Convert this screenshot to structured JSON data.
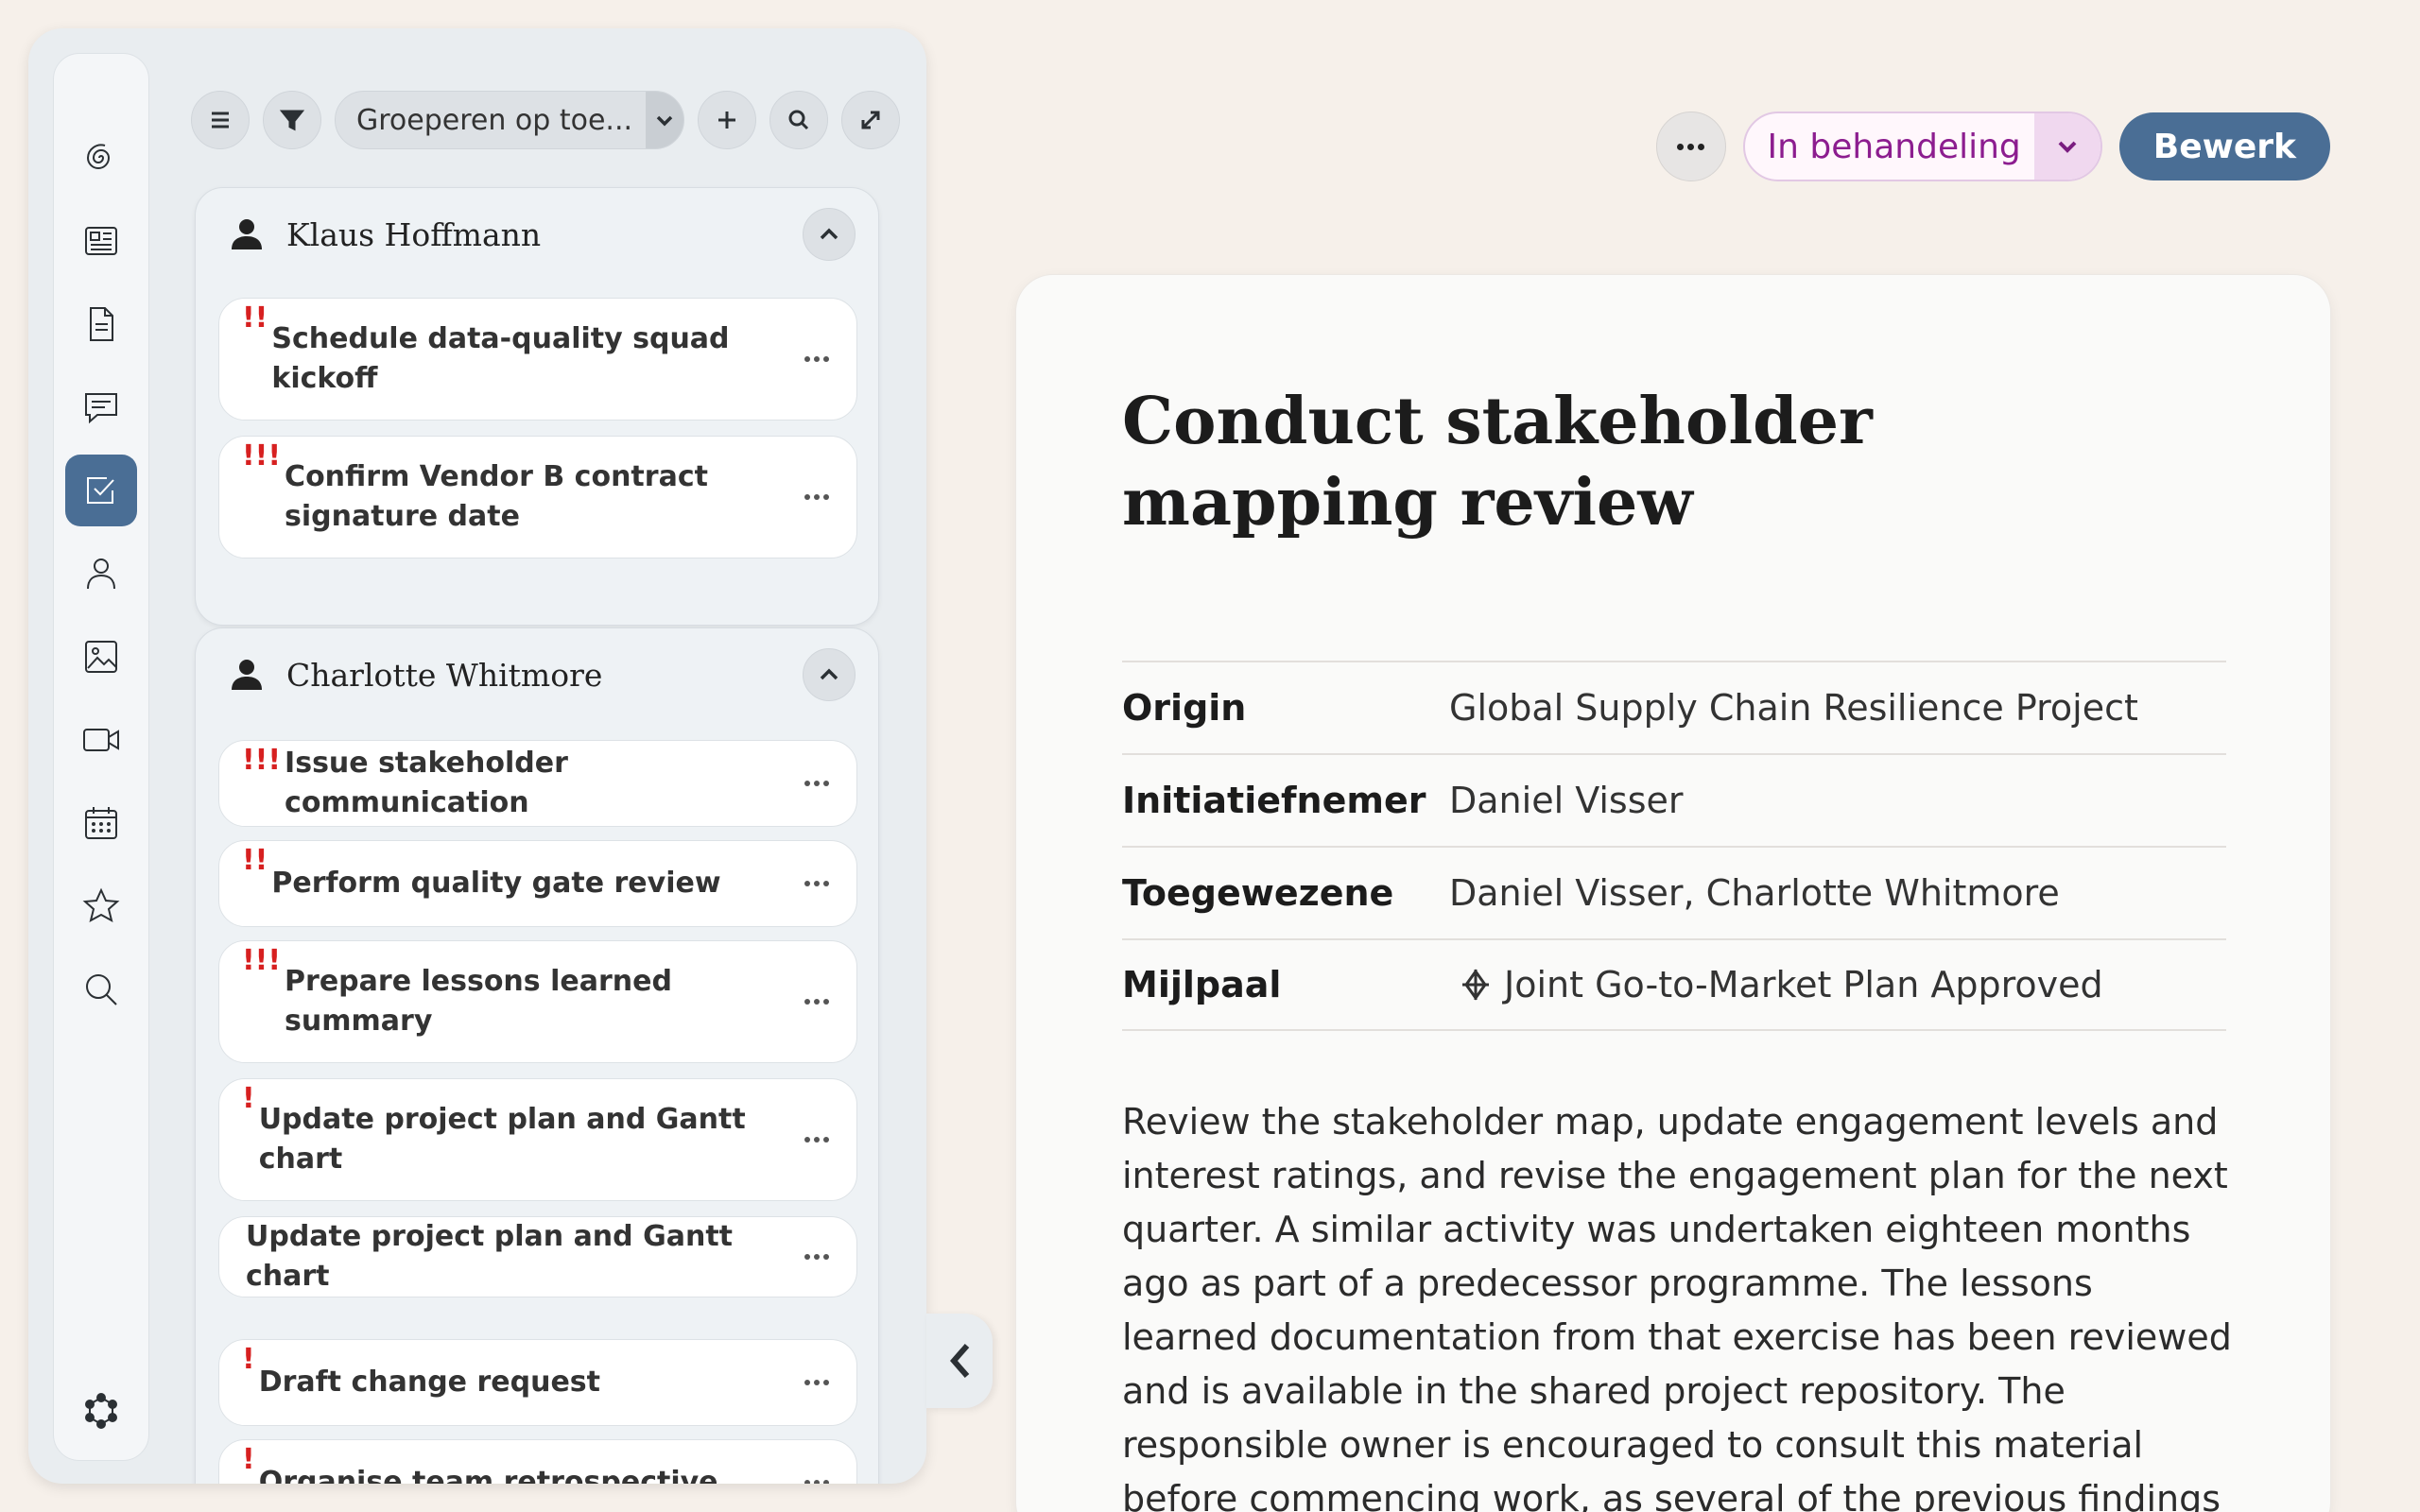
{
  "toolbar": {
    "group_select_label": "Groeperen op toe..."
  },
  "groups": [
    {
      "name": "Klaus Hoffmann",
      "tasks": [
        {
          "priority": "!!",
          "title": "Schedule data-quality squad kickoff"
        },
        {
          "priority": "!!!",
          "title": "Confirm Vendor B contract signature date"
        }
      ]
    },
    {
      "name": "Charlotte Whitmore",
      "tasks": [
        {
          "priority": "!!!",
          "title": "Issue stakeholder communication"
        },
        {
          "priority": "!!",
          "title": "Perform quality gate review"
        },
        {
          "priority": "!!!",
          "title": "Prepare lessons learned summary"
        },
        {
          "priority": "!",
          "title": "Update project plan and Gantt chart"
        },
        {
          "priority": "",
          "title": "Update project plan and Gantt chart"
        },
        {
          "priority": "!",
          "title": "Draft change request"
        },
        {
          "priority": "!",
          "title": "Organise team retrospective"
        }
      ]
    }
  ],
  "header": {
    "status_label": "In behandeling",
    "edit_label": "Bewerk"
  },
  "detail": {
    "title": "Conduct stakeholder mapping review",
    "properties": [
      {
        "key": "Origin",
        "value": "Global Supply Chain Resilience Project"
      },
      {
        "key": "Initiatiefnemer",
        "value": "Daniel Visser"
      },
      {
        "key": "Toegewezene",
        "value": "Daniel Visser, Charlotte Whitmore"
      },
      {
        "key": "Mijlpaal",
        "value": "Joint Go-to-Market Plan Approved",
        "icon": "milestone-icon"
      }
    ],
    "description": "Review the stakeholder map, update engagement levels and interest ratings, and revise the engagement plan for the next quarter. A similar activity was undertaken eighteen months ago as part of a predecessor programme. The lessons learned documentation from that exercise has been reviewed and is available in the shared project repository. The responsible owner is encouraged to consult this material before commencing work, as several of the previous findings are directly applicable. Budget monitoring for"
  },
  "colors": {
    "accent": "#4a6e95",
    "priority": "#d72020",
    "status_text": "#8c1d8f",
    "background": "#f6f0ea"
  },
  "icons": {
    "rail": [
      "spiral-logo-icon",
      "news-icon",
      "document-icon",
      "chat-icon",
      "tasks-icon",
      "person-icon",
      "image-icon",
      "video-icon",
      "calendar-icon",
      "star-icon",
      "search-icon",
      "settings-network-icon"
    ]
  }
}
